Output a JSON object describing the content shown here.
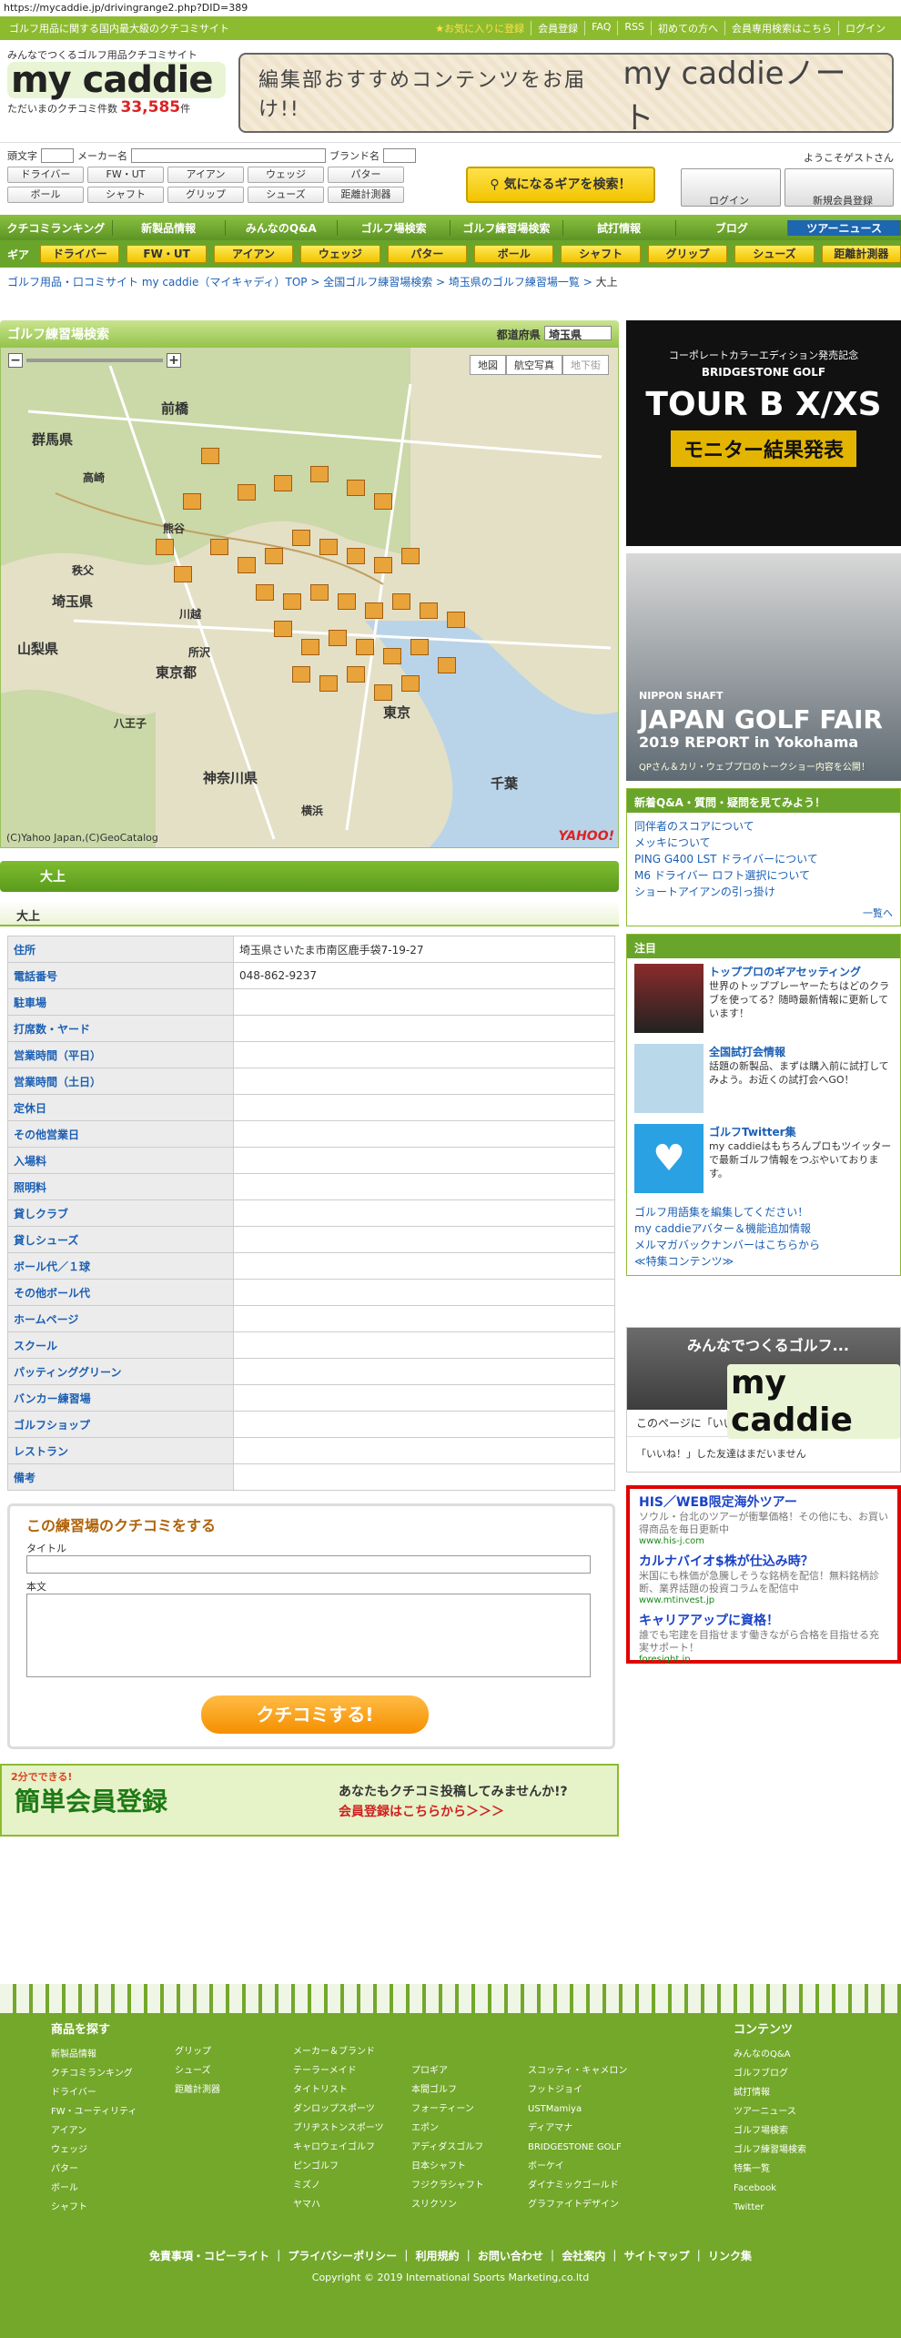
{
  "url": "https://mycaddie.jp/drivingrange2.php?DID=389",
  "topbar": {
    "tagline": "ゴルフ用品に関する国内最大級のクチコミサイト",
    "links": [
      "★お気に入りに登録",
      "会員登録",
      "FAQ",
      "RSS",
      "初めての方へ",
      "会員専用検索はこちら",
      "ログイン"
    ]
  },
  "logo": {
    "catch": "みんなでつくるゴルフ用品クチコミサイト",
    "name": "my caddie",
    "count_label": "ただいまのクチコミ件数",
    "count": "33,585",
    "count_unit": "件"
  },
  "banner": {
    "text1": "編集部おすすめコンテンツをお届け!!",
    "text2": "my caddieノート"
  },
  "search": {
    "label_initial": "頭文字",
    "label_maker": "メーカー名",
    "label_brand": "ブランド名",
    "row1": [
      "ドライバー",
      "FW・UT",
      "アイアン",
      "ウェッジ",
      "パター"
    ],
    "row2": [
      "ボール",
      "シャフト",
      "グリップ",
      "シューズ",
      "距離計測器"
    ],
    "find_button": "気になるギアを検索！",
    "guest": "ようこそゲストさん",
    "login": "ログイン",
    "register": "新規会員登録"
  },
  "nav": [
    "クチコミランキング",
    "新製品情報",
    "みんなのQ&A",
    "ゴルフ場検索",
    "ゴルフ練習場検索",
    "試打情報",
    "ブログ",
    "ツアーニュース"
  ],
  "gearbar": {
    "label": "ギア",
    "items": [
      "ドライバー",
      "FW・UT",
      "アイアン",
      "ウェッジ",
      "パター",
      "ボール",
      "シャフト",
      "グリップ",
      "シューズ",
      "距離計測器"
    ]
  },
  "breadcrumb": {
    "items": [
      "ゴルフ用品・口コミサイト my caddie（マイキャディ）TOP",
      "全国ゴルフ練習場検索",
      "埼玉県のゴルフ練習場一覧"
    ],
    "current": "大上"
  },
  "map": {
    "title": "ゴルフ練習場検索",
    "pref_label": "都道府県",
    "pref_value": "埼玉県",
    "tabs": [
      "地図",
      "航空写真",
      "地下街"
    ],
    "labels": [
      "前橋",
      "群馬県",
      "埼玉県",
      "東京都",
      "東京",
      "千葉",
      "神奈川県",
      "山梨県",
      "高崎",
      "熊谷",
      "秩父",
      "川越",
      "所沢",
      "八王子",
      "横浜"
    ],
    "copyright": "(C)Yahoo Japan,(C)GeoCatalog",
    "yahoo": "YAHOO!"
  },
  "facility": {
    "name": "大上",
    "subtitle": "大上",
    "rows": [
      {
        "k": "住所",
        "v": "埼玉県さいたま市南区鹿手袋7-19-27"
      },
      {
        "k": "電話番号",
        "v": "048-862-9237"
      },
      {
        "k": "駐車場",
        "v": ""
      },
      {
        "k": "打席数・ヤード",
        "v": ""
      },
      {
        "k": "営業時間（平日）",
        "v": ""
      },
      {
        "k": "営業時間（土日）",
        "v": ""
      },
      {
        "k": "定休日",
        "v": ""
      },
      {
        "k": "その他営業日",
        "v": ""
      },
      {
        "k": "入場料",
        "v": ""
      },
      {
        "k": "照明料",
        "v": ""
      },
      {
        "k": "貸しクラブ",
        "v": ""
      },
      {
        "k": "貸しシューズ",
        "v": ""
      },
      {
        "k": "ボール代／１球",
        "v": ""
      },
      {
        "k": "その他ボール代",
        "v": ""
      },
      {
        "k": "ホームページ",
        "v": ""
      },
      {
        "k": "スクール",
        "v": ""
      },
      {
        "k": "パッティンググリーン",
        "v": ""
      },
      {
        "k": "バンカー練習場",
        "v": ""
      },
      {
        "k": "ゴルフショップ",
        "v": ""
      },
      {
        "k": "レストラン",
        "v": ""
      },
      {
        "k": "備考",
        "v": ""
      }
    ]
  },
  "review": {
    "title": "この練習場のクチコミをする",
    "title_label": "タイトル",
    "body_label": "本文",
    "submit": "クチコミする!"
  },
  "signup": {
    "left": "簡単会員登録",
    "badge": "2分でできる!",
    "right1": "あなたもクチコミ投稿してみませんか!?",
    "right2": "会員登録はこちらから＞＞＞"
  },
  "side": {
    "ad1": {
      "a": "コーポレートカラーエディション発売記念",
      "b": "BRIDGESTONE GOLF",
      "c": "TOUR B X/XS",
      "d": "モニター結果発表"
    },
    "ad2": {
      "e": "NIPPON SHAFT",
      "f": "JAPAN GOLF FAIR",
      "g": "2019 REPORT in Yokohama",
      "h": "QPさん＆カリ・ウェブプロのトークショー内容を公開！"
    },
    "qa": {
      "title": "新着Q&A・質問・疑問を見てみよう！",
      "items": [
        "同伴者のスコアについて",
        "メッキについて",
        "PING G400 LST ドライバーについて",
        "M6 ドライバー ロフト選択について",
        "ショートアイアンの引っ掛け"
      ],
      "more": "一覧へ"
    },
    "attention": {
      "title": "注目",
      "items": [
        {
          "t": "トッププロのギアセッティング",
          "d": "世界のトッププレーヤーたちはどのクラブを使ってる？随時最新情報に更新しています！"
        },
        {
          "t": "全国試打会情報",
          "d": "話題の新製品、まずは購入前に試打してみよう。お近くの試打会へGO！"
        },
        {
          "t": "ゴルフTwitter集",
          "d": "my caddieはもちろんプロもツイッターで最新ゴルフ情報をつぶやいております。"
        }
      ],
      "links": [
        "ゴルフ用語集を編集してください！",
        "my caddieアバター＆機能追加情報",
        "メルマガバックナンバーはこちらから",
        "≪特集コンテンツ≫"
      ]
    },
    "fb": {
      "t1": "みんなでつくるゴルフ...",
      "t2": "my caddie",
      "like": "このページに「いいね！」",
      "none": "「いいね！」した友達はまだいません"
    },
    "textads": [
      {
        "t": "HIS／WEB限定海外ツアー",
        "d": "ソウル・台北のツアーが衝撃価格！その他にも、お買い得商品を毎日更新中",
        "u": "www.his-j.com"
      },
      {
        "t": "カルナバイオ$株が仕込み時？",
        "d": "米国にも株価が急騰しそうな銘柄を配信！無料銘柄診断、業界話題の投資コラムを配信中",
        "u": "www.mtinvest.jp"
      },
      {
        "t": "キャリアアップに資格！",
        "d": "誰でも宅建を目指せます働きながら合格を目指せる充実サポート！",
        "u": "foresight.jp"
      }
    ]
  },
  "footer": {
    "goods_title": "商品を探す",
    "col1": [
      "新製品情報",
      "クチコミランキング",
      "ドライバー",
      "FW・ユーティリティ",
      "アイアン",
      "ウェッジ",
      "パター",
      "ボール",
      "シャフト"
    ],
    "col2": [
      "グリップ",
      "シューズ",
      "距離計測器"
    ],
    "col3": [
      "メーカー＆ブランド",
      "テーラーメイド",
      "タイトリスト",
      "ダンロップスポーツ",
      "ブリヂストンスポーツ",
      "キャロウェイゴルフ",
      "ピンゴルフ",
      "ミズノ",
      "ヤマハ"
    ],
    "col4": [
      "プロギア",
      "本間ゴルフ",
      "フォーティーン",
      "エポン",
      "アディダスゴルフ",
      "日本シャフト",
      "フジクラシャフト",
      "スリクソン"
    ],
    "col5": [
      "スコッティ・キャメロン",
      "フットジョイ",
      "USTMamiya",
      "ディアマナ",
      "BRIDGESTONE GOLF",
      "ボーケイ",
      "ダイナミックゴールド",
      "グラファイトデザイン"
    ],
    "contents_title": "コンテンツ",
    "col6": [
      "みんなのQ&A",
      "ゴルフブログ",
      "試打情報",
      "ツアーニュース",
      "ゴルフ場検索",
      "ゴルフ練習場検索",
      "特集一覧",
      "Facebook",
      "Twitter"
    ],
    "links": "免責事項・コピーライト ｜ プライバシーポリシー ｜ 利用規約 ｜ お問い合わせ ｜ 会社案内 ｜ サイトマップ ｜ リンク集",
    "copyright": "Copyright © 2019 International Sports Marketing,co.ltd"
  }
}
